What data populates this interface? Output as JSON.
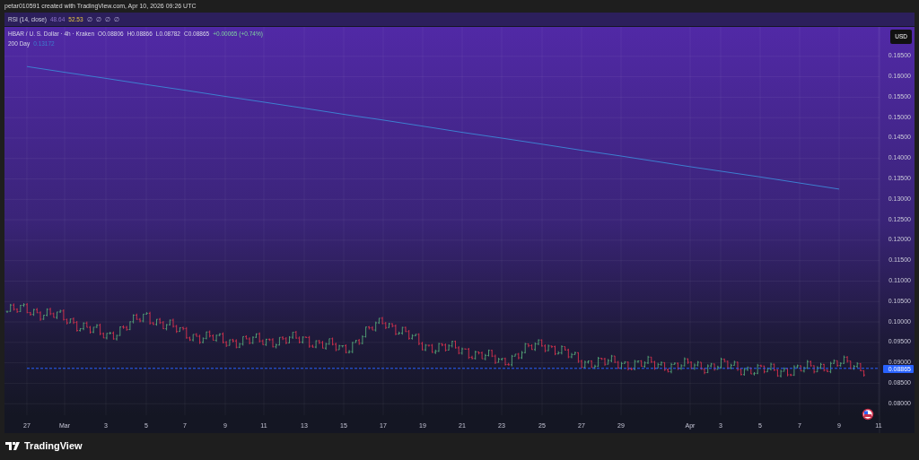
{
  "attribution": "petar010591 created with TradingView.com, Apr 10, 2026 09:26 UTC",
  "rsi_legend": {
    "name": "RSI (14, close)",
    "value_1": "48.64",
    "value_2": "52.53",
    "flags": [
      "∅",
      "∅",
      "∅",
      "∅"
    ]
  },
  "legend": {
    "symbol": "HBAR / U. S. Dollar · 4h · Kraken",
    "open": "O0.08806",
    "high": "H0.08866",
    "low": "L0.08782",
    "close": "C0.08865",
    "change": "+0.00065 (+0.74%)"
  },
  "indicator": {
    "value": "0.13172"
  },
  "currency": "USD",
  "last_price": "0.08865",
  "chart_data": {
    "type": "line",
    "grid": true,
    "categories": [
      "27",
      "Mar",
      "3",
      "5",
      "7",
      "9",
      "11",
      "13",
      "15",
      "17",
      "19",
      "21",
      "23",
      "25",
      "27",
      "29",
      "Apr",
      "3",
      "5",
      "7",
      "9",
      "11"
    ],
    "series": [
      {
        "name": "200 Day",
        "color": "#3d7fd0",
        "values": [
          0.1625,
          0.1611,
          0.1596,
          0.1581,
          0.1567,
          0.1552,
          0.1538,
          0.1523,
          0.1508,
          0.1494,
          0.1479,
          0.1464,
          0.145,
          0.1435,
          0.142,
          0.1406,
          0.138,
          0.1369,
          0.1355,
          0.134,
          0.1325,
          null
        ]
      },
      {
        "color": "#2962ff",
        "line_style": "dashed",
        "values": [
          0.08865,
          0.08865,
          0.08865,
          0.08865,
          0.08865,
          0.08865,
          0.08865,
          0.08865,
          0.08865,
          0.08865,
          0.08865,
          0.08865,
          0.08865,
          0.08865,
          0.08865,
          0.08865,
          0.08865,
          0.08865,
          0.08865,
          0.08865,
          0.08865,
          0.08865
        ]
      }
    ],
    "ylim": [
      0.0728,
      0.1722
    ],
    "yticks": [
      {
        "value": 0.08,
        "label": "0.08000"
      },
      {
        "value": 0.085,
        "label": "0.08500"
      },
      {
        "value": 0.09,
        "label": "0.09000"
      },
      {
        "value": 0.095,
        "label": "0.09500"
      },
      {
        "value": 0.1,
        "label": "0.10000"
      },
      {
        "value": 0.105,
        "label": "0.10500"
      },
      {
        "value": 0.11,
        "label": "0.11000"
      },
      {
        "value": 0.115,
        "label": "0.11500"
      },
      {
        "value": 0.12,
        "label": "0.12000"
      },
      {
        "value": 0.125,
        "label": "0.12500"
      },
      {
        "value": 0.13,
        "label": "0.13000"
      },
      {
        "value": 0.135,
        "label": "0.13500"
      },
      {
        "value": 0.14,
        "label": "0.14000"
      },
      {
        "value": 0.145,
        "label": "0.14500"
      },
      {
        "value": 0.15,
        "label": "0.15000"
      },
      {
        "value": 0.155,
        "label": "0.15500"
      },
      {
        "value": 0.16,
        "label": "0.16000"
      },
      {
        "value": 0.165,
        "label": "0.16500"
      }
    ]
  },
  "logo": "TradingView"
}
